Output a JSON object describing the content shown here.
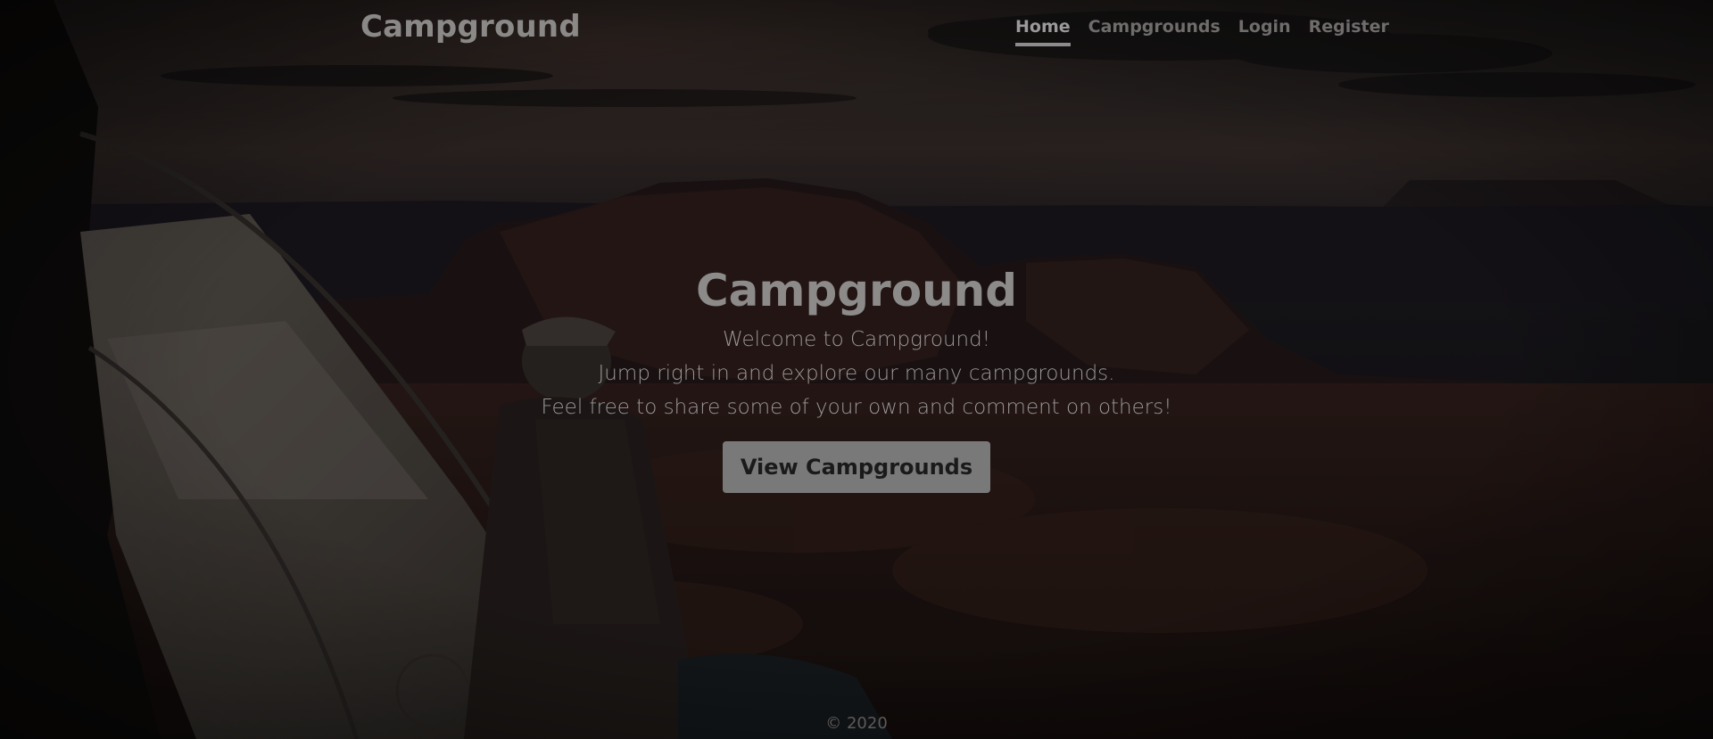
{
  "brand": {
    "name": "Campground"
  },
  "nav": {
    "items": [
      {
        "label": "Home",
        "active": true
      },
      {
        "label": "Campgrounds",
        "active": false
      },
      {
        "label": "Login",
        "active": false
      },
      {
        "label": "Register",
        "active": false
      }
    ]
  },
  "hero": {
    "title": "Campground",
    "lines": [
      "Welcome to Campground!",
      "Jump right in and explore our many campgrounds.",
      "Feel free to share some of your own and comment on others!"
    ],
    "cta_label": "View Campgrounds"
  },
  "footer": {
    "text": "© 2020"
  },
  "background": {
    "description_icon": "camping-landscape-photo",
    "colors": {
      "sky": "#1e1a19",
      "sky_glow": "#3a2a25",
      "mountains": "#1a1414",
      "valley": "#1b1212",
      "accent_button": "#7a7979"
    }
  }
}
